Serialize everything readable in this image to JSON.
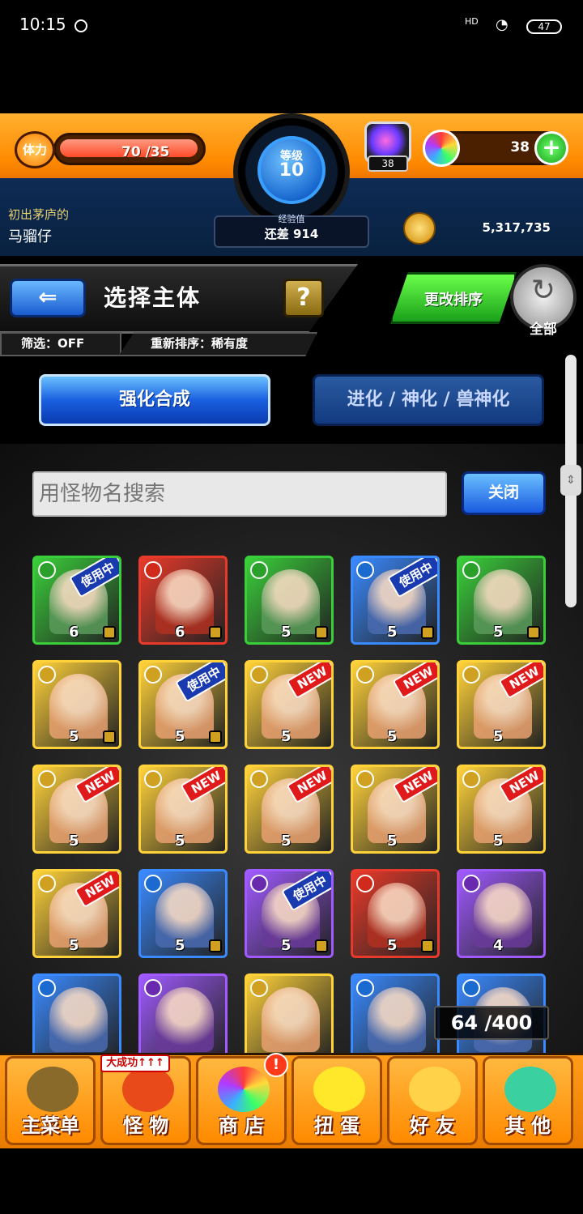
{
  "status_bar": {
    "time": "10:15",
    "signal": "HD",
    "wifi": "wifi",
    "battery": "47"
  },
  "header": {
    "stamina_label": "体力",
    "stamina_value": "70 /35",
    "level_label": "等级",
    "level_value": "10",
    "exp_label": "经验值",
    "exp_value": "还差 914",
    "gem_count": "38",
    "orb_count": "38",
    "add_symbol": "+",
    "player_title": "初出茅庐的",
    "player_name": "马骝仔",
    "coins": "5,317,735"
  },
  "title_bar": {
    "back_symbol": "⇐",
    "title": "选择主体",
    "help_symbol": "?",
    "filter": "筛选：OFF",
    "sort": "重新排序：稀有度",
    "change_sort": "更改排序",
    "all_label": "全部"
  },
  "tabs": {
    "enhance": "强化合成",
    "evolve": "进化 / 神化 / 兽神化"
  },
  "search": {
    "placeholder": "用怪物名搜索",
    "close_label": "关闭"
  },
  "colors": {
    "accent_orange": "#ff8a00",
    "accent_blue": "#1a60e0",
    "new_badge": "#e01a1a",
    "in_use_badge": "#1a3ab0"
  },
  "monsters": [
    {
      "level": "6",
      "badge": "使用中",
      "locked": true,
      "frame": "green",
      "attr": "wood"
    },
    {
      "level": "6",
      "badge": "",
      "locked": true,
      "frame": "red",
      "attr": "fire"
    },
    {
      "level": "5",
      "badge": "",
      "locked": true,
      "frame": "green",
      "attr": "wood"
    },
    {
      "level": "5",
      "badge": "使用中",
      "locked": true,
      "frame": "blue",
      "attr": "water"
    },
    {
      "level": "5",
      "badge": "",
      "locked": true,
      "frame": "green",
      "attr": "wood"
    },
    {
      "level": "5",
      "badge": "",
      "locked": true,
      "frame": "yellow",
      "attr": "light"
    },
    {
      "level": "5",
      "badge": "使用中",
      "locked": true,
      "frame": "yellow",
      "attr": "light"
    },
    {
      "level": "5",
      "badge": "NEW",
      "locked": false,
      "frame": "yellow",
      "attr": "light"
    },
    {
      "level": "5",
      "badge": "NEW",
      "locked": false,
      "frame": "yellow",
      "attr": "light"
    },
    {
      "level": "5",
      "badge": "NEW",
      "locked": false,
      "frame": "yellow",
      "attr": "light"
    },
    {
      "level": "5",
      "badge": "NEW",
      "locked": false,
      "frame": "yellow",
      "attr": "light"
    },
    {
      "level": "5",
      "badge": "NEW",
      "locked": false,
      "frame": "yellow",
      "attr": "light"
    },
    {
      "level": "5",
      "badge": "NEW",
      "locked": false,
      "frame": "yellow",
      "attr": "light"
    },
    {
      "level": "5",
      "badge": "NEW",
      "locked": false,
      "frame": "yellow",
      "attr": "light"
    },
    {
      "level": "5",
      "badge": "NEW",
      "locked": false,
      "frame": "yellow",
      "attr": "light"
    },
    {
      "level": "5",
      "badge": "NEW",
      "locked": false,
      "frame": "yellow",
      "attr": "light"
    },
    {
      "level": "5",
      "badge": "",
      "locked": true,
      "frame": "blue",
      "attr": "water"
    },
    {
      "level": "5",
      "badge": "使用中",
      "locked": true,
      "frame": "purple",
      "attr": "dark"
    },
    {
      "level": "5",
      "badge": "",
      "locked": true,
      "frame": "red",
      "attr": "fire"
    },
    {
      "level": "4",
      "badge": "",
      "locked": false,
      "frame": "purple",
      "attr": "dark"
    },
    {
      "level": "",
      "badge": "",
      "locked": false,
      "frame": "blue",
      "attr": "water"
    },
    {
      "level": "",
      "badge": "",
      "locked": false,
      "frame": "purple",
      "attr": "dark"
    },
    {
      "level": "",
      "badge": "",
      "locked": false,
      "frame": "yellow",
      "attr": "light"
    },
    {
      "level": "",
      "badge": "",
      "locked": false,
      "frame": "blue",
      "attr": "water"
    },
    {
      "level": "",
      "badge": "",
      "locked": false,
      "frame": "blue",
      "attr": "water"
    }
  ],
  "box_count": "64 /400",
  "bottom_nav": {
    "banner": "大成功↑↑↑",
    "shop_alert": "!",
    "items": [
      {
        "label": "主菜单",
        "icon": "chest-icon"
      },
      {
        "label": "怪 物",
        "icon": "monster-icon"
      },
      {
        "label": "商 店",
        "icon": "orb-icon"
      },
      {
        "label": "扭 蛋",
        "icon": "egg-icon"
      },
      {
        "label": "好 友",
        "icon": "balloon-icon"
      },
      {
        "label": "其 他",
        "icon": "question-icon"
      }
    ]
  }
}
